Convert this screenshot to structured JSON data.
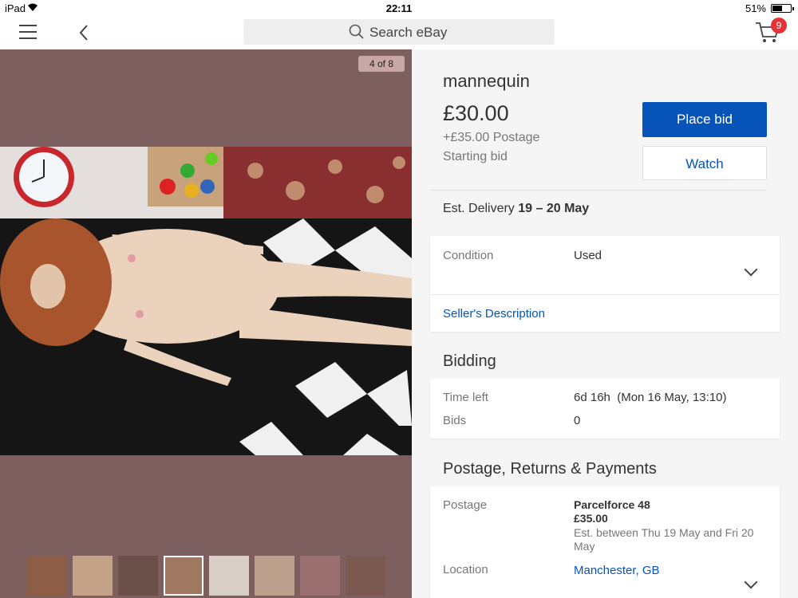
{
  "status_bar": {
    "device": "iPad",
    "time": "22:11",
    "battery": "51%"
  },
  "header": {
    "search_placeholder": "Search eBay",
    "cart_count": "9"
  },
  "gallery": {
    "counter": "4 of 8",
    "thumbnail_count": 8,
    "selected_thumbnail": 4
  },
  "listing": {
    "title": "mannequin",
    "price": "£30.00",
    "postage": "+£35.00 Postage",
    "price_type": "Starting bid",
    "place_bid_label": "Place bid",
    "watch_label": "Watch",
    "delivery_label": "Est. Delivery",
    "delivery_dates": "19 – 20 May"
  },
  "details": {
    "condition_label": "Condition",
    "condition_value": "Used",
    "seller_description_link": "Seller's Description"
  },
  "bidding": {
    "section_title": "Bidding",
    "time_left_label": "Time left",
    "time_left_value": "6d 16h  (Mon 16 May, 13:10)",
    "bids_label": "Bids",
    "bids_value": "0"
  },
  "shipping": {
    "section_title": "Postage, Returns & Payments",
    "postage_label": "Postage",
    "service": "Parcelforce 48",
    "cost": "£35.00",
    "estimate": "Est. between Thu 19 May and Fri 20 May",
    "location_label": "Location",
    "location_value": "Manchester, GB"
  },
  "colors": {
    "accent": "#0654ba",
    "badge": "#e53238",
    "gallery_bg": "#7e5f5f"
  }
}
